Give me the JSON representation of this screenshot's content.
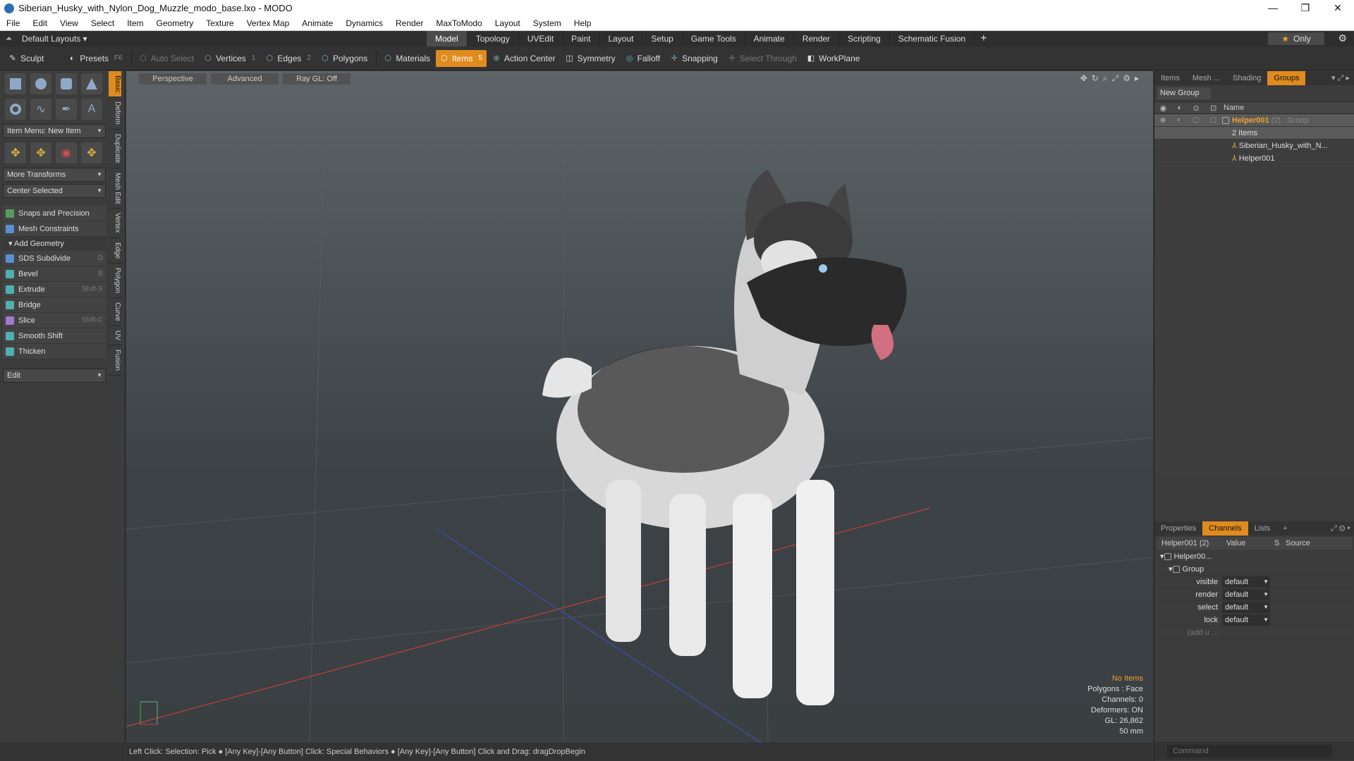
{
  "window": {
    "title": "Siberian_Husky_with_Nylon_Dog_Muzzle_modo_base.lxo - MODO",
    "controls": [
      "—",
      "❐",
      "✕"
    ]
  },
  "menu": [
    "File",
    "Edit",
    "View",
    "Select",
    "Item",
    "Geometry",
    "Texture",
    "Vertex Map",
    "Animate",
    "Dynamics",
    "Render",
    "MaxToModo",
    "Layout",
    "System",
    "Help"
  ],
  "layoutbar": {
    "layouts_label": "Default Layouts ▾",
    "tabs": [
      "Model",
      "Topology",
      "UVEdit",
      "Paint",
      "Layout",
      "Setup",
      "Game Tools",
      "Animate",
      "Render",
      "Scripting",
      "Schematic Fusion"
    ],
    "active_tab": "Model",
    "only_label": "Only"
  },
  "toolbar": {
    "sculpt": "Sculpt",
    "presets": "Presets",
    "presets_key": "F6",
    "auto_select": "Auto Select",
    "vertices": "Vertices",
    "vertices_key": "1",
    "edges": "Edges",
    "edges_key": "2",
    "polygons": "Polygons",
    "materials": "Materials",
    "items": "Items",
    "items_key": "5",
    "action_center": "Action Center",
    "symmetry": "Symmetry",
    "falloff": "Falloff",
    "snapping": "Snapping",
    "select_through": "Select Through",
    "workplane": "WorkPlane"
  },
  "leftpanel": {
    "item_menu": "Item Menu: New Item",
    "more_transforms": "More Transforms",
    "center_selected": "Center Selected",
    "snaps": "Snaps and Precision",
    "mesh_constraints": "Mesh Constraints",
    "add_geometry": "Add Geometry",
    "tools": [
      {
        "label": "SDS Subdivide",
        "key": "D",
        "color": "#5a8fd0"
      },
      {
        "label": "Bevel",
        "key": "B",
        "color": "#4fb0b0"
      },
      {
        "label": "Extrude",
        "key": "Shift-X",
        "color": "#4fb0b0"
      },
      {
        "label": "Bridge",
        "key": "",
        "color": "#4fb0b0"
      },
      {
        "label": "Slice",
        "key": "Shift-C",
        "color": "#a07ad0"
      },
      {
        "label": "Smooth Shift",
        "key": "",
        "color": "#4fb0b0"
      },
      {
        "label": "Thicken",
        "key": "",
        "color": "#4fb0b0"
      }
    ],
    "edit": "Edit",
    "vtabs": [
      "Basic",
      "Deform",
      "Duplicate",
      "Mesh Edit",
      "Vertex",
      "Edge",
      "Polygon",
      "Curve",
      "UV",
      "Fusion"
    ]
  },
  "viewport": {
    "perspective": "Perspective",
    "advanced": "Advanced",
    "raygl": "Ray GL: Off",
    "info": {
      "no_items": "No Items",
      "polygons": "Polygons : Face",
      "channels": "Channels: 0",
      "deformers": "Deformers: ON",
      "gl": "GL: 26,862",
      "mm": "50 mm"
    }
  },
  "statusbar": "Left Click: Selection: Pick ● [Any Key]-[Any Button] Click: Special Behaviors ● [Any Key]-[Any Button] Click and Drag: dragDropBegin",
  "rightpanel": {
    "tabs": [
      "Items",
      "Mesh ...",
      "Shading",
      "Groups"
    ],
    "active_tab": "Groups",
    "new_group": "New Group",
    "name_col": "Name",
    "tree": {
      "group_name": "Helper001",
      "group_suffix": " (2) : Group",
      "group_count": "2 Items",
      "child1": "Siberian_Husky_with_N...",
      "child2": "Helper001"
    },
    "ptabs": [
      "Properties",
      "Channels",
      "Lists"
    ],
    "active_ptab": "Channels",
    "chan_header": {
      "name": "Helper001 (2)",
      "value": "Value",
      "s": "S",
      "source": "Source"
    },
    "chan_tree": {
      "root": "Helper00...",
      "group": "Group"
    },
    "channels": [
      {
        "k": "visible",
        "v": "default"
      },
      {
        "k": "render",
        "v": "default"
      },
      {
        "k": "select",
        "v": "default"
      },
      {
        "k": "lock",
        "v": "default"
      }
    ],
    "add_user": "(add u ...",
    "command_placeholder": "Command"
  }
}
